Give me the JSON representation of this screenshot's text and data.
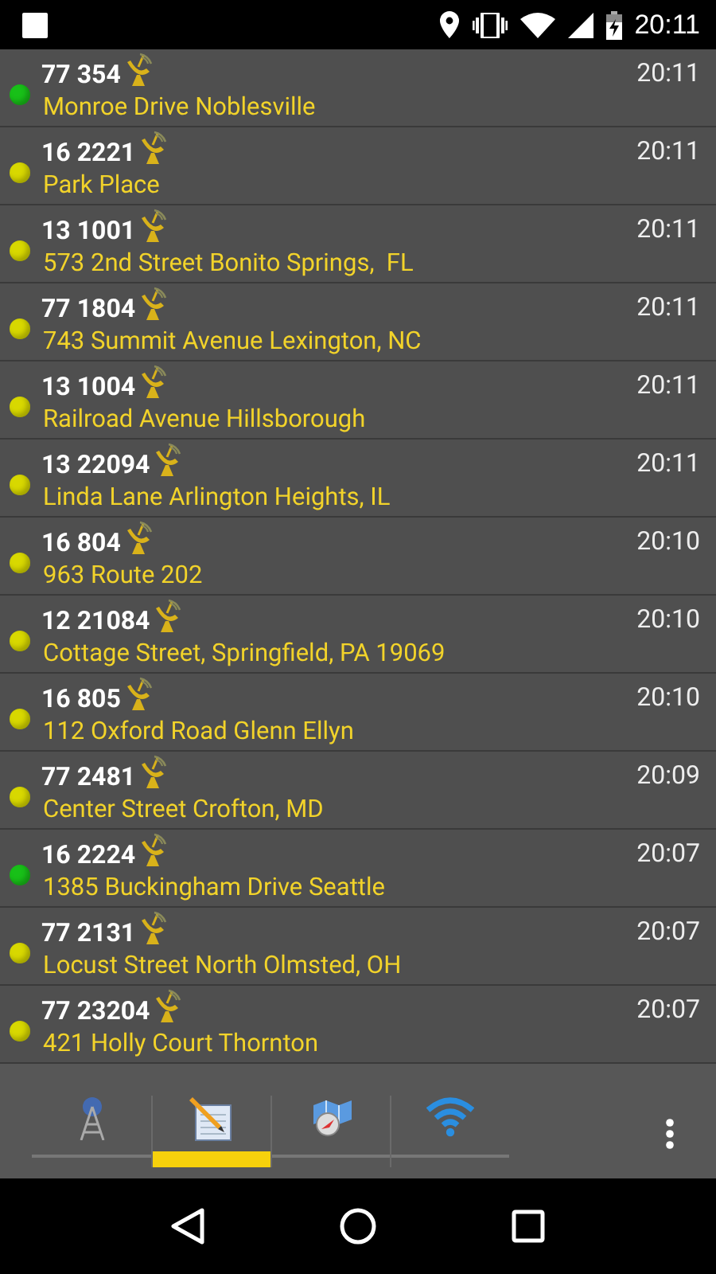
{
  "status_bar": {
    "time": "20:11"
  },
  "rows": [
    {
      "number": "77 354",
      "time": "20:11",
      "address": "Monroe Drive Noblesville",
      "color": "#18c018"
    },
    {
      "number": "16 2221",
      "time": "20:11",
      "address": "Park Place",
      "color": "#d8d800"
    },
    {
      "number": "13 1001",
      "time": "20:11",
      "address": "573 2nd Street Bonito Springs,  FL",
      "color": "#d8d800"
    },
    {
      "number": "77 1804",
      "time": "20:11",
      "address": "743 Summit Avenue Lexington, NC",
      "color": "#d8d800"
    },
    {
      "number": "13 1004",
      "time": "20:11",
      "address": "Railroad Avenue Hillsborough",
      "color": "#d8d800"
    },
    {
      "number": "13 22094",
      "time": "20:11",
      "address": "Linda Lane Arlington Heights, IL",
      "color": "#d8d800"
    },
    {
      "number": "16 804",
      "time": "20:10",
      "address": "963 Route 202",
      "color": "#d8d800"
    },
    {
      "number": "12 21084",
      "time": "20:10",
      "address": "Cottage Street, Springfield, PA 19069",
      "color": "#d8d800"
    },
    {
      "number": "16 805",
      "time": "20:10",
      "address": "112 Oxford Road Glenn Ellyn",
      "color": "#d8d800"
    },
    {
      "number": "77 2481",
      "time": "20:09",
      "address": "Center Street Crofton, MD",
      "color": "#d8d800"
    },
    {
      "number": "16 2224",
      "time": "20:07",
      "address": "1385 Buckingham Drive Seattle",
      "color": "#18c018"
    },
    {
      "number": "77 2131",
      "time": "20:07",
      "address": "Locust Street North Olmsted, OH",
      "color": "#d8d800"
    },
    {
      "number": "77 23204",
      "time": "20:07",
      "address": "421 Holly Court Thornton",
      "color": "#d8d800"
    }
  ],
  "tabs": [
    {
      "kind": "tower",
      "selected": false
    },
    {
      "kind": "notepad",
      "selected": true
    },
    {
      "kind": "map",
      "selected": false
    },
    {
      "kind": "wifi",
      "selected": false
    }
  ]
}
